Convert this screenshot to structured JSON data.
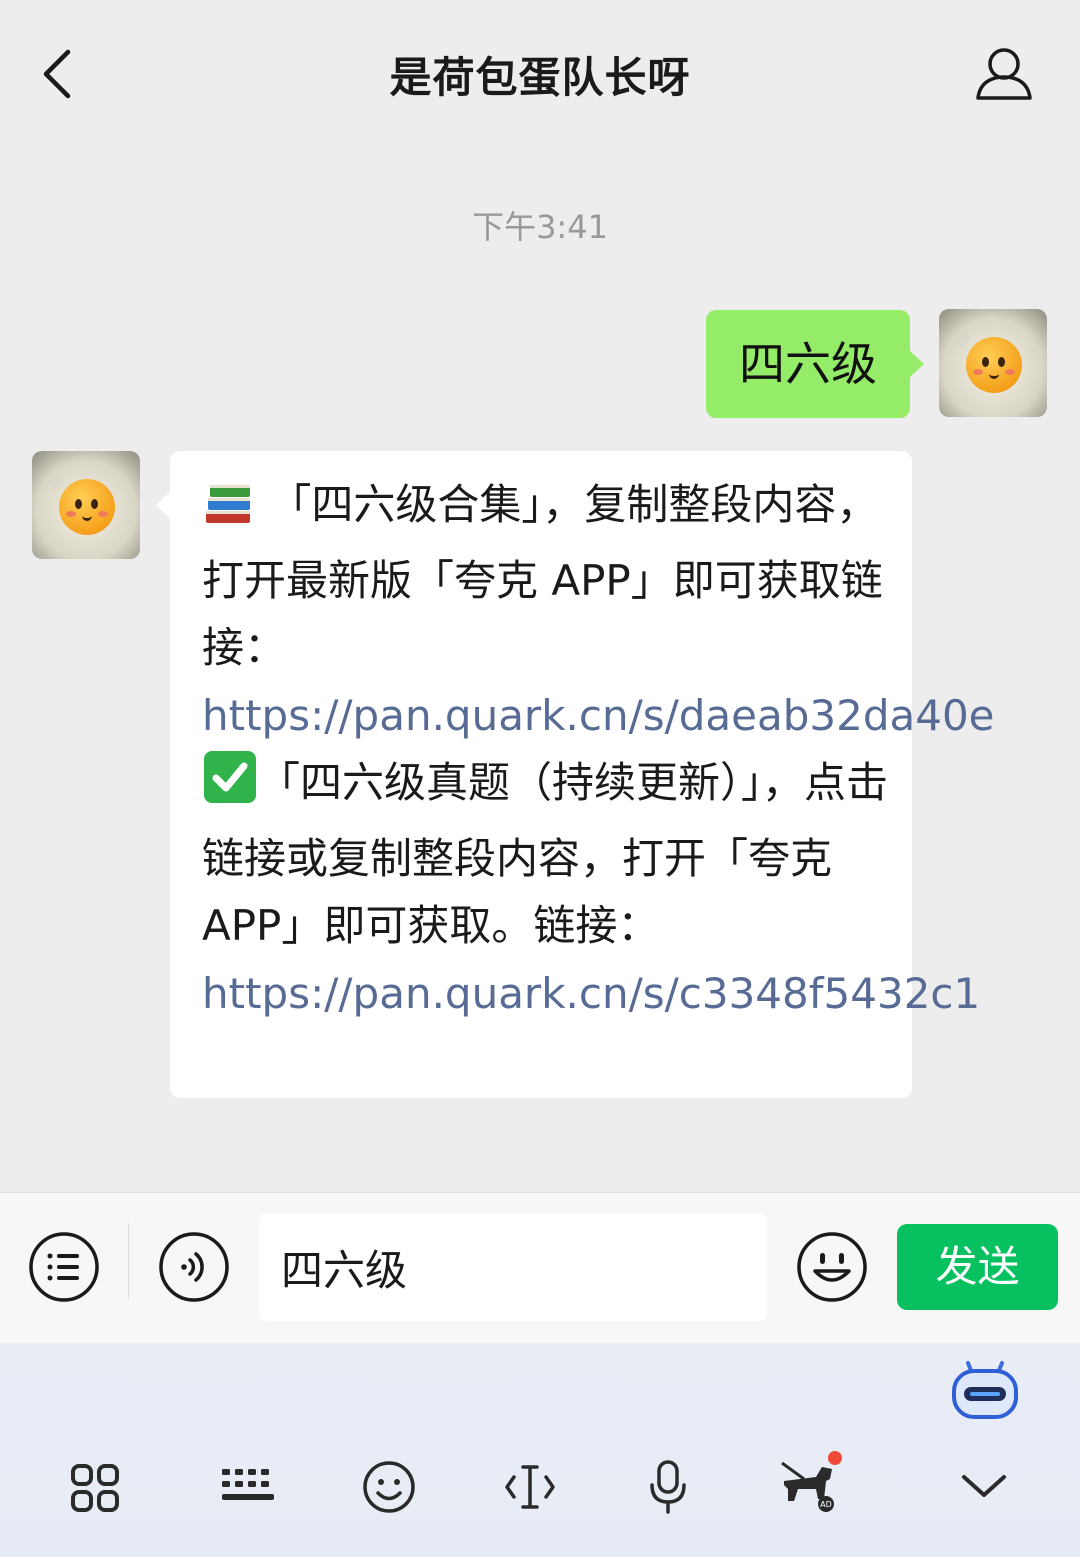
{
  "header": {
    "title": "是荷包蛋队长呀"
  },
  "chat": {
    "timestamp": "下午3:41",
    "sent_message": "四六级",
    "received": {
      "part1": "「四六级合集」，复制整段内容，打开最新版「夸克 APP」即可获取链接：",
      "link1": "https://pan.quark.cn/s/daeab32da40e",
      "part2": "「四六级真题（持续更新）」，点击链接或复制整段内容，打开「夸克 APP」即可获取。链接：",
      "link2": "https://pan.quark.cn/s/c3348f5432c1"
    }
  },
  "input": {
    "value": "四六级",
    "send_label": "发送"
  },
  "colors": {
    "sent_bubble": "#95ec69",
    "send_button": "#07c160",
    "link": "#576b95"
  },
  "icons": {
    "back": "chevron-left-icon",
    "profile": "user-icon",
    "menu": "list-icon",
    "voice": "voice-icon",
    "emoji": "smiley-icon",
    "keyboard_toolbar": [
      "grid-icon",
      "keyboard-icon",
      "emoji-icon",
      "text-cursor-icon",
      "microphone-icon",
      "guide-dog-icon",
      "chevron-down-icon"
    ],
    "assistant": "robot-assistant-icon"
  }
}
